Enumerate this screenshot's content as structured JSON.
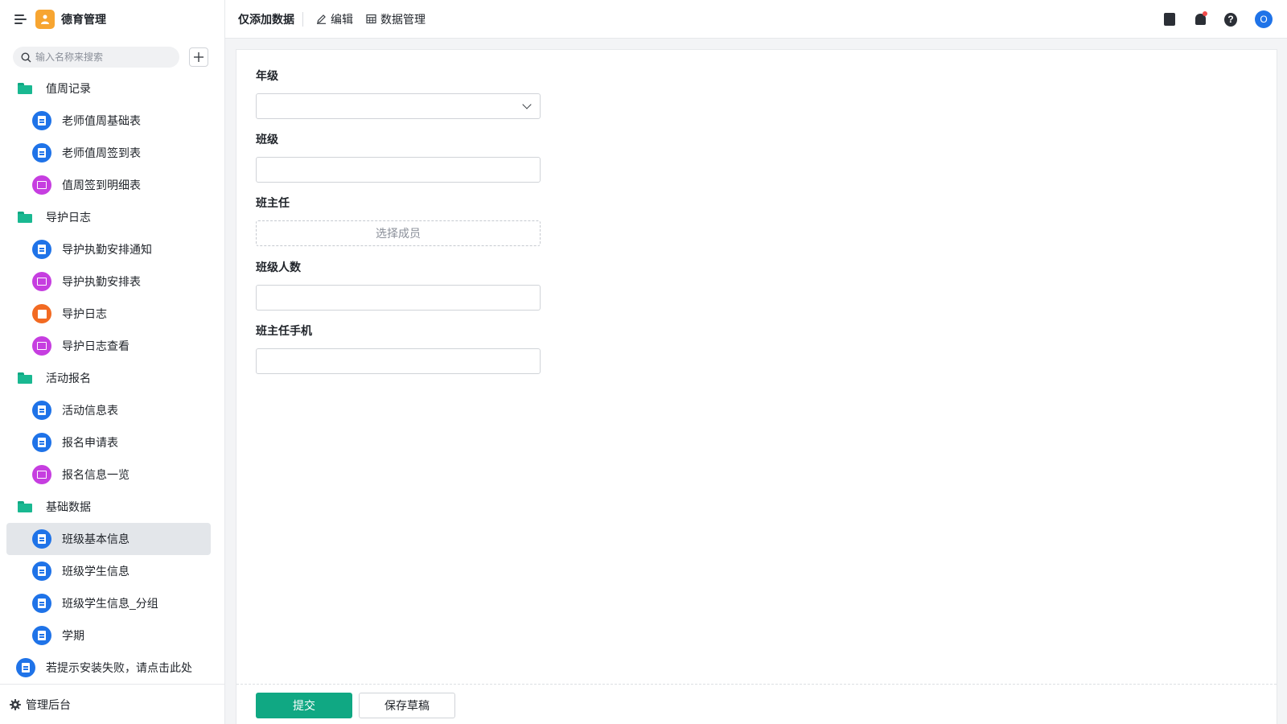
{
  "app": {
    "title": "德育管理"
  },
  "search": {
    "placeholder": "输入名称来搜索"
  },
  "nav": [
    {
      "type": "folder",
      "label": "值周记录"
    },
    {
      "type": "form",
      "label": "老师值周基础表"
    },
    {
      "type": "form",
      "label": "老师值周签到表"
    },
    {
      "type": "report",
      "label": "值周签到明细表"
    },
    {
      "type": "folder",
      "label": "导护日志"
    },
    {
      "type": "form",
      "label": "导护执勤安排通知"
    },
    {
      "type": "report",
      "label": "导护执勤安排表"
    },
    {
      "type": "flow",
      "label": "导护日志"
    },
    {
      "type": "report",
      "label": "导护日志查看"
    },
    {
      "type": "folder",
      "label": "活动报名"
    },
    {
      "type": "form",
      "label": "活动信息表"
    },
    {
      "type": "form",
      "label": "报名申请表"
    },
    {
      "type": "report",
      "label": "报名信息一览"
    },
    {
      "type": "folder",
      "label": "基础数据"
    },
    {
      "type": "form",
      "label": "班级基本信息",
      "active": true
    },
    {
      "type": "form",
      "label": "班级学生信息"
    },
    {
      "type": "form",
      "label": "班级学生信息_分组"
    },
    {
      "type": "form",
      "label": "学期"
    },
    {
      "type": "root-form",
      "label": "若提示安装失败，请点击此处"
    }
  ],
  "sidebar_footer": {
    "label": "管理后台"
  },
  "topbar": {
    "title": "仅添加数据",
    "edit_label": "编辑",
    "data_label": "数据管理",
    "avatar_letter": "O",
    "help_glyph": "?"
  },
  "form": {
    "grade_label": "年级",
    "class_label": "班级",
    "teacher_label": "班主任",
    "teacher_placeholder": "选择成员",
    "count_label": "班级人数",
    "phone_label": "班主任手机",
    "submit_label": "提交",
    "draft_label": "保存草稿"
  },
  "colors": {
    "accent": "#10a883",
    "form_icon": "#1f73e8",
    "report_icon": "#c63ee0",
    "flow_icon": "#f26a22",
    "app_logo": "#f7a531"
  }
}
